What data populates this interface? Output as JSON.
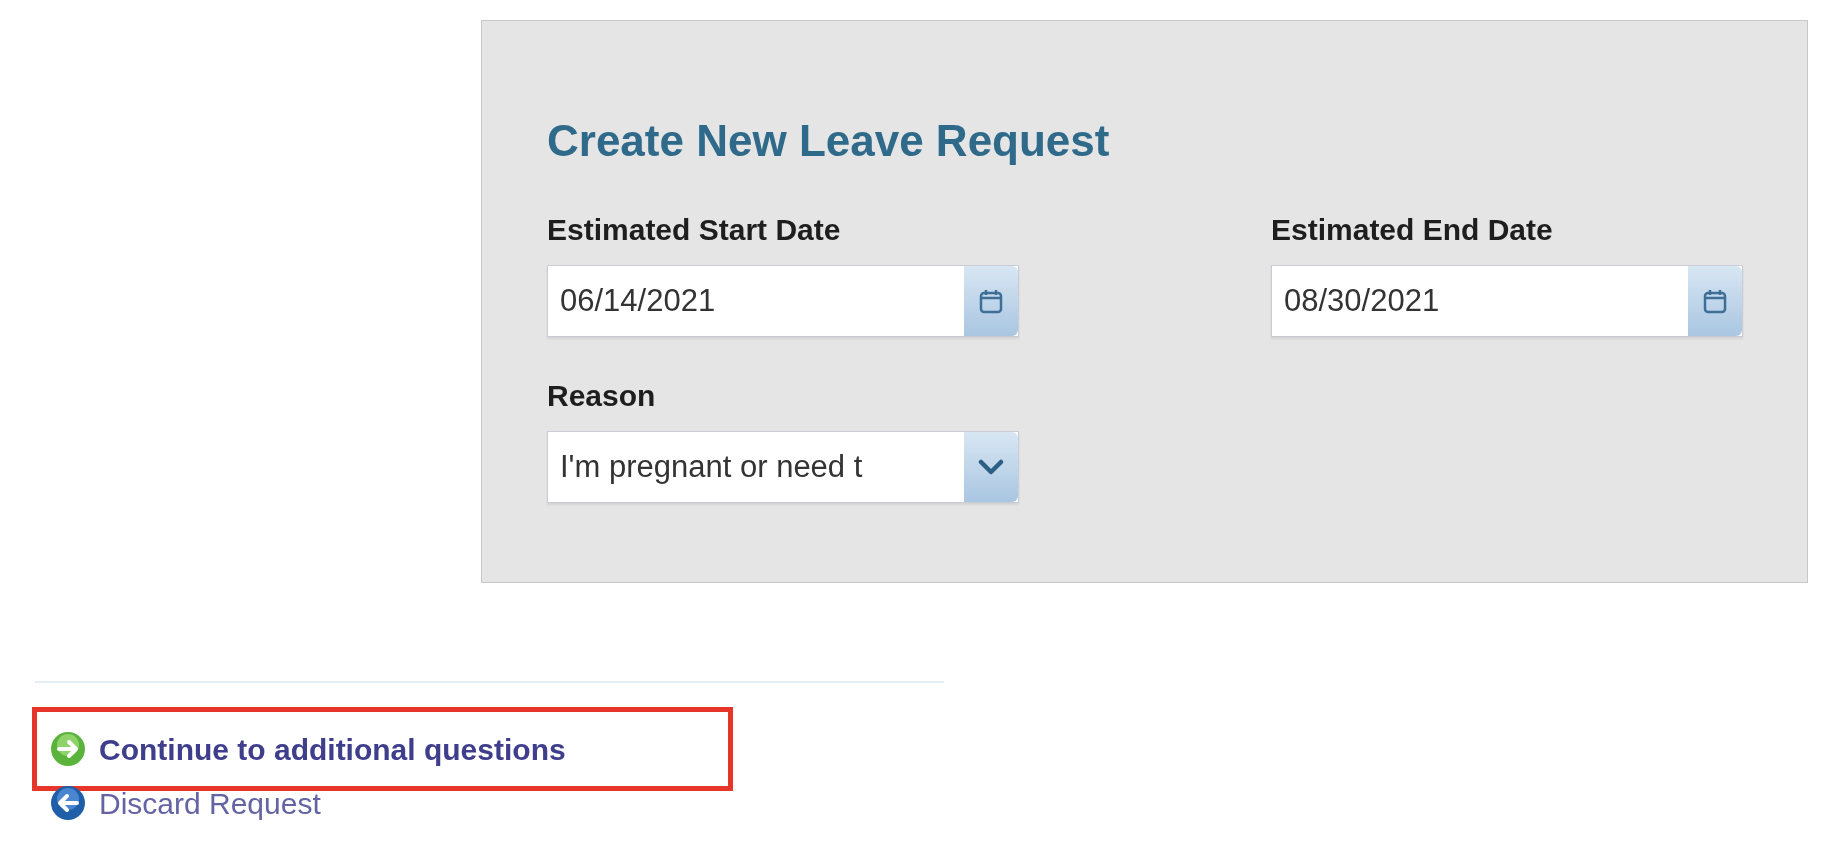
{
  "form": {
    "title": "Create New Leave Request",
    "fields": [
      {
        "label": "Estimated Start Date",
        "value": "06/14/2021",
        "kind": "date"
      },
      {
        "label": "Estimated End Date",
        "value": "08/30/2021",
        "kind": "date"
      },
      {
        "label": "Reason",
        "value": "I'm pregnant or need t",
        "kind": "select"
      }
    ]
  },
  "actions": [
    {
      "label": "Continue to additional questions",
      "kind": "continue",
      "highlighted": true
    },
    {
      "label": "Discard Request",
      "kind": "discard",
      "highlighted": false
    }
  ]
}
